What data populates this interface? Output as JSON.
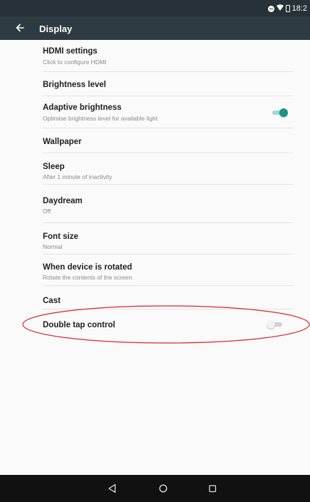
{
  "status_bar": {
    "time": "18:2"
  },
  "app_bar": {
    "title": "Display"
  },
  "settings": [
    {
      "title": "HDMI settings",
      "summary": "Click to configure HDMI"
    },
    {
      "title": "Brightness level"
    },
    {
      "title": "Adaptive brightness",
      "summary": "Optimise brightness level for available light",
      "switch_on": true
    },
    {
      "title": "Wallpaper"
    },
    {
      "title": "Sleep",
      "summary": "After 1 minute of inactivity"
    },
    {
      "title": "Daydream",
      "summary": "Off"
    },
    {
      "title": "Font size",
      "summary": "Normal"
    },
    {
      "title": "When device is rotated",
      "summary": "Rotate the contents of the screen"
    },
    {
      "title": "Cast"
    },
    {
      "title": "Double tap control",
      "switch_on": false
    }
  ],
  "colors": {
    "status_bar": "#263238",
    "app_bar": "#2f3b42",
    "accent": "#1a9486",
    "annotation": "#d9262b"
  },
  "icons": {
    "back": "arrow-left-icon",
    "nav_back": "triangle-back-icon",
    "nav_home": "circle-home-icon",
    "nav_recents": "square-recents-icon"
  }
}
